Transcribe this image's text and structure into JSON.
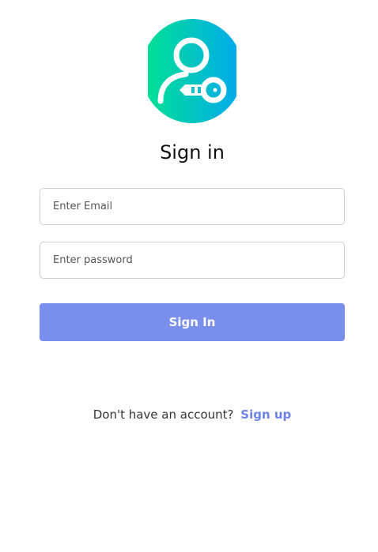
{
  "logo": {
    "icon": "user-key-icon",
    "gradient_start": "#00e38f",
    "gradient_end": "#00a8f0"
  },
  "title": "Sign in",
  "email": {
    "placeholder": "Enter Email",
    "value": ""
  },
  "password": {
    "placeholder": "Enter password",
    "value": ""
  },
  "submit_label": "Sign In",
  "footer": {
    "prompt": "Don't have an account?",
    "link": "Sign up"
  },
  "colors": {
    "accent": "#7a8fec",
    "link": "#6d84e6"
  }
}
